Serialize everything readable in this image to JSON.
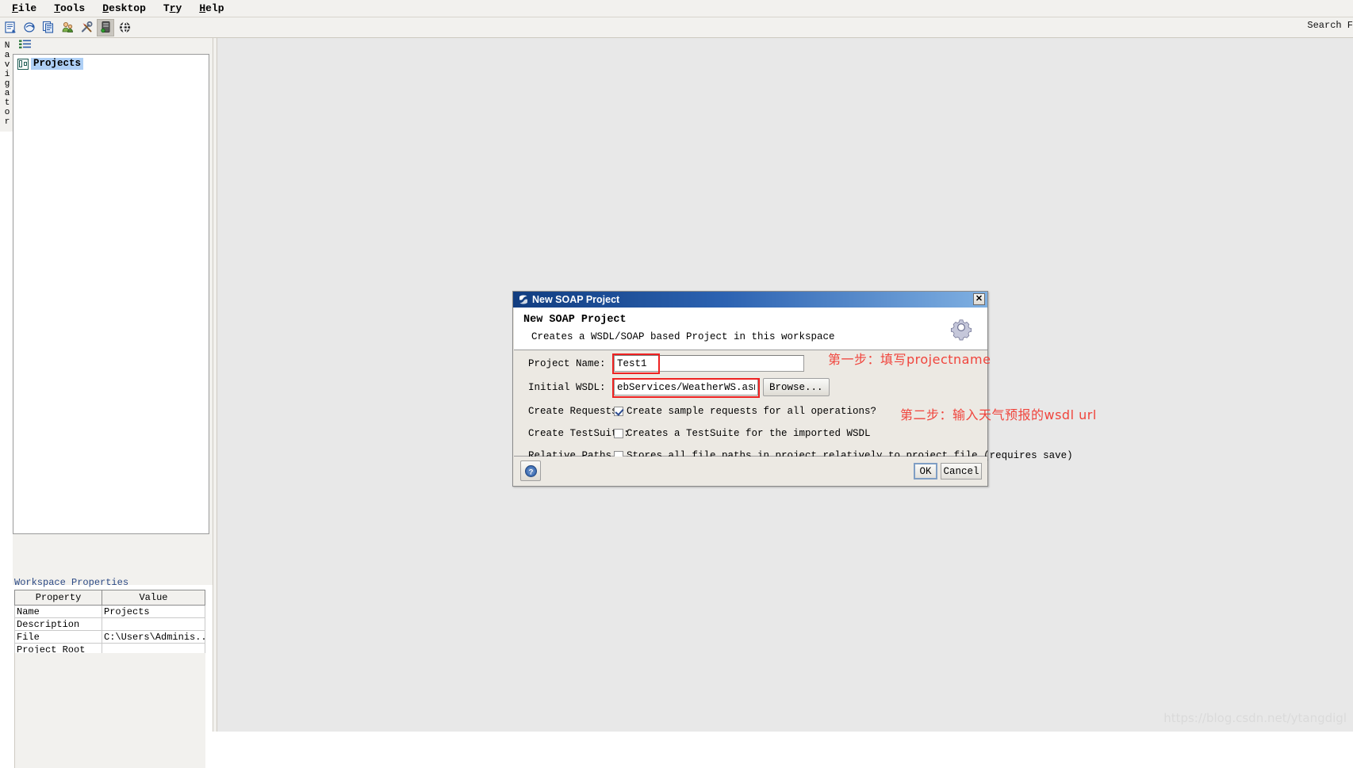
{
  "app": {
    "menu": [
      {
        "label": "File",
        "mnemonic": "F"
      },
      {
        "label": "Tools",
        "mnemonic": "T"
      },
      {
        "label": "Desktop",
        "mnemonic": "D"
      },
      {
        "label": "Try",
        "mnemonic": "r"
      },
      {
        "label": "Help",
        "mnemonic": "H"
      }
    ],
    "toolbar": {
      "icons": [
        "new-soap-project-icon",
        "new-rest-project-icon",
        "import-project-icon",
        "new-workspace-icon",
        "preferences-icon",
        "server-icon",
        "globe-icon"
      ],
      "selected_index": 5,
      "search_label": "Search F"
    }
  },
  "navigator": {
    "tab_label": "Navigator",
    "toolbar_icon": "list-view-icon",
    "tree": [
      {
        "icon": "projects-icon",
        "label": "Projects",
        "selected": true
      }
    ]
  },
  "workspace_properties": {
    "title": "Workspace Properties",
    "columns": [
      "Property",
      "Value"
    ],
    "rows": [
      {
        "property": "Name",
        "value": "Projects"
      },
      {
        "property": "Description",
        "value": ""
      },
      {
        "property": "File",
        "value": "C:\\Users\\Adminis..."
      },
      {
        "property": "Project Root",
        "value": ""
      }
    ]
  },
  "dialog": {
    "titlebar": {
      "title": "New SOAP Project",
      "logo_icon": "soapui-logo-icon",
      "close_label": "✕"
    },
    "header": {
      "heading": "New SOAP Project",
      "subheading": "Creates a WSDL/SOAP based Project in this workspace",
      "gear_icon": "gear-icon"
    },
    "fields": {
      "project_name": {
        "label": "Project Name:",
        "value": "Test1",
        "placeholder": ""
      },
      "initial_wsdl": {
        "label": "Initial WSDL:",
        "value": "ebServices/WeatherWS.asmx?wsdl",
        "placeholder": "",
        "browse_label": "Browse..."
      },
      "create_requests": {
        "label": "Create Requests:",
        "checkbox_text": "Create sample requests for all operations?",
        "checked": true
      },
      "create_testsuite": {
        "label": "Create TestSuite:",
        "checkbox_text": "Creates a TestSuite for the imported WSDL",
        "checked": false
      },
      "relative_paths": {
        "label": "Relative Paths:",
        "checkbox_text": "Stores all file paths in project relatively to project file (requires save)",
        "checked": false
      }
    },
    "footer": {
      "help_icon": "help-question-icon",
      "ok_label": "OK",
      "cancel_label": "Cancel"
    }
  },
  "annotations": [
    {
      "text": "第一步：填写projectname",
      "color": "#f0443c"
    },
    {
      "text": "第二步：输入天气预报的wsdl url",
      "color": "#f0443c"
    }
  ],
  "watermark": "https://blog.csdn.net/ytangdigl"
}
